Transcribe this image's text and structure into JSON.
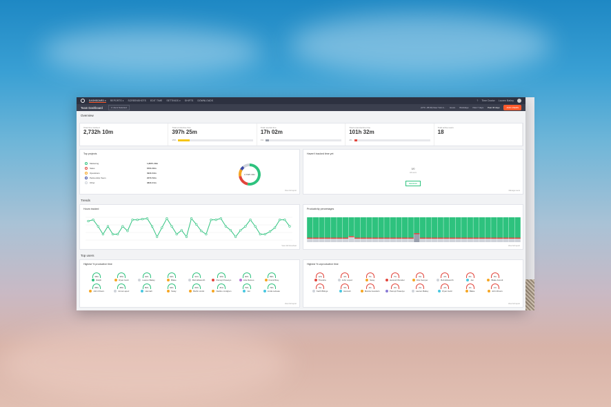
{
  "nav": {
    "items": [
      "DASHBOARD ▾",
      "REPORTS ▾",
      "SCREENSHOTS",
      "EDIT TIME",
      "SETTINGS ▾",
      "SHIFTS",
      "DOWNLOADS"
    ],
    "user": "Lauren Bailey",
    "org": "Time Doctor"
  },
  "subnav": {
    "title": "Team Dashboard",
    "selector": "1 Users Selected",
    "timezone": "(UTC -05:00) New York A...",
    "periods": [
      "Hours",
      "Workdays",
      "Past 7 days",
      "Past 30 days"
    ],
    "cta": "ADD USERS"
  },
  "overview": {
    "heading": "Overview",
    "stats": [
      {
        "label": "Total time tracked",
        "value": "2,732h 10m"
      },
      {
        "label": "Total productive time",
        "value": "397h 25m",
        "pct": "15%",
        "fill": 0.15,
        "color": "#f5c518"
      },
      {
        "label": "Total neutral time",
        "value": "17h 02m",
        "pct": "1%",
        "fill": 0.01,
        "color": "#9aa0ad"
      },
      {
        "label": "Total unproductive time",
        "value": "101h 32m",
        "pct": "4%",
        "fill": 0.04,
        "color": "#e2453c"
      },
      {
        "label": "Total active users",
        "value": "18"
      }
    ]
  },
  "projects": {
    "title": "Top projects",
    "items": [
      {
        "name": "Marketing",
        "time": "1,887h 29m",
        "color": "#2ec27e"
      },
      {
        "name": "Sales",
        "time": "670h 36m",
        "color": "#e2453c"
      },
      {
        "name": "Operations",
        "time": "394h 34m",
        "color": "#f5a623"
      },
      {
        "name": "Partnership Team",
        "time": "207h 52m",
        "color": "#3b4aa6"
      },
      {
        "name": "Other",
        "time": "384h 21m",
        "color": "#cfd3da"
      }
    ],
    "donut_center": "2,732h 10m",
    "link": "View full report"
  },
  "haventtracked": {
    "title": "Haven't tracked time yet",
    "empty": "All users",
    "count": "0/0",
    "button": "REMIND",
    "link": "Manage users"
  },
  "trends": {
    "heading": "Trends",
    "hours_title": "Hours tracked",
    "prod_title": "Productivity percentages",
    "link1": "View full timesheet",
    "link2": "View full report"
  },
  "chart_data": [
    {
      "type": "line",
      "title": "Hours tracked",
      "values": [
        3,
        3.2,
        2.2,
        1,
        2.2,
        1,
        1,
        2.2,
        1.5,
        3.2,
        3.2,
        3.3,
        3.4,
        2.2,
        0.6,
        2,
        3.4,
        2.2,
        1,
        1.6,
        0.6,
        3.4,
        2.5,
        1.5,
        1,
        3.2,
        3.2,
        3.4,
        2.2,
        1.6,
        0.6,
        1.6,
        2.2,
        3.2,
        2.2,
        1,
        1,
        1.4,
        2,
        3.2,
        3.2,
        2.2
      ]
    },
    {
      "type": "bar",
      "title": "Productivity percentages",
      "series": [
        {
          "values": [
            0.82,
            0.82,
            0.82,
            0.82,
            0.82,
            0.82,
            0.82,
            0.76,
            0.82,
            0.82,
            0.82,
            0.82,
            0.82,
            0.82,
            0.82,
            0.82,
            0.82,
            0.82,
            0.64,
            0.82,
            0.82,
            0.82,
            0.82,
            0.82,
            0.82,
            0.82,
            0.82,
            0.82,
            0.82,
            0.82,
            0.82,
            0.82,
            0.82,
            0.82,
            0.82,
            0.82
          ]
        }
      ]
    }
  ],
  "topusers": {
    "heading": "Top users",
    "prod_title": "Highest % productive time",
    "unprod_title": "Highest % unproductive time",
    "prod": [
      {
        "p": "98%",
        "n": "Ralph",
        "c": "#2ec27e"
      },
      {
        "p": "95%",
        "n": "Ryan Gold",
        "c": "#f5a623"
      },
      {
        "p": "94%",
        "n": "Lauren Bailey",
        "c": "#cfd3da"
      },
      {
        "p": "92%",
        "n": "Blake",
        "c": "#f5a623"
      },
      {
        "p": "91%",
        "n": "Bob Ellsworth",
        "c": "#cfd3da"
      },
      {
        "p": "90%",
        "n": "Pamuji Prasetyo",
        "c": "#e2453c"
      },
      {
        "p": "90%",
        "n": "Lilia Ramos",
        "c": "#b86fd6"
      },
      {
        "p": "89%",
        "n": "Frank Bray",
        "c": "#f5a623"
      },
      {
        "p": "88%",
        "n": "John Rivers",
        "c": "#f5a623"
      },
      {
        "p": "88%",
        "n": "Anna Lopez",
        "c": "#cfd3da"
      },
      {
        "p": "85%",
        "n": "Hannah",
        "c": "#48c7e0"
      },
      {
        "p": "84%",
        "n": "Sway",
        "c": "#f5a623"
      },
      {
        "p": "83%",
        "n": "Barbi Lindol",
        "c": "#f5a623"
      },
      {
        "p": "81%",
        "n": "Nadine Lindgren",
        "c": "#f5a623"
      },
      {
        "p": "79%",
        "n": "Jen",
        "c": "#48c7e0"
      },
      {
        "p": "79%",
        "n": "Linda Lebeau",
        "c": "#48c7e0"
      }
    ],
    "unprod": [
      {
        "p": "12%",
        "n": "Thandra",
        "c": "#e2453c"
      },
      {
        "p": "9%",
        "n": "John Lopez",
        "c": "#cfd3da"
      },
      {
        "p": "7%",
        "n": "Sway",
        "c": "#f5a623"
      },
      {
        "p": "7%",
        "n": "Hannah Wonder",
        "c": "#e2453c"
      },
      {
        "p": "6%",
        "n": "Otis Kemper",
        "c": "#f5a623"
      },
      {
        "p": "6%",
        "n": "Bob Ellsworth",
        "c": "#cfd3da"
      },
      {
        "p": "6%",
        "n": "Jen",
        "c": "#48c7e0"
      },
      {
        "p": "5%",
        "n": "Blake Arendi",
        "c": "#f5a623"
      },
      {
        "p": "5%",
        "n": "Keith Bilings",
        "c": "#cfd3da"
      },
      {
        "p": "5%",
        "n": "Hannah",
        "c": "#48c7e0"
      },
      {
        "p": "4%",
        "n": "Marcia Goodwin",
        "c": "#f5a623"
      },
      {
        "p": "3%",
        "n": "Pamuji Prasetyo",
        "c": "#8a7bd6"
      },
      {
        "p": "2%",
        "n": "Lauren Bailey",
        "c": "#cfd3da"
      },
      {
        "p": "2%",
        "n": "Ryan Gold",
        "c": "#48c7e0"
      },
      {
        "p": "1%",
        "n": "Blake",
        "c": "#f5a623"
      },
      {
        "p": "1%",
        "n": "John Rivers",
        "c": "#f5a623"
      }
    ],
    "link": "View full report"
  }
}
